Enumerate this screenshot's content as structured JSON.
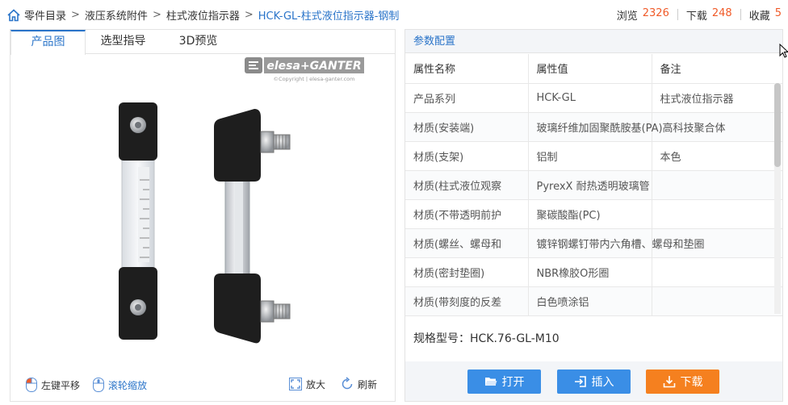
{
  "breadcrumb": {
    "items": [
      "零件目录",
      "液压系统附件",
      "柱式液位指示器",
      "HCK-GL-柱式液位指示器-钢制"
    ],
    "separator": ">"
  },
  "stats": {
    "views_label": "浏览",
    "views": "2326",
    "downloads_label": "下载",
    "downloads": "248",
    "favorites_label": "收藏",
    "favorites": "5"
  },
  "tabs": [
    "产品图",
    "选型指导",
    "3D预览"
  ],
  "viewer": {
    "logo_text": "elesa+GANTER",
    "logo_sub": "©Copyright | elesa-ganter.com",
    "left_drag": "左键平移",
    "wheel_zoom": "滚轮缩放",
    "zoom": "放大",
    "refresh": "刷新"
  },
  "params": {
    "title": "参数配置",
    "headers": [
      "属性名称",
      "属性值",
      "备注"
    ],
    "rows": [
      [
        "产品系列",
        "HCK-GL",
        "柱式液位指示器"
      ],
      [
        "材质(安装端)",
        "玻璃纤维加固聚酰胺基(PA)高科技聚合体",
        ""
      ],
      [
        "材质(支架)",
        "铝制",
        "本色"
      ],
      [
        "材质(柱式液位观察",
        "PyrexX 耐热透明玻璃管",
        ""
      ],
      [
        "材质(不带透明前护",
        "聚碳酸酯(PC)",
        ""
      ],
      [
        "材质(螺丝、螺母和",
        "镀锌钢螺钉带内六角槽、螺母和垫圈",
        ""
      ],
      [
        "材质(密封垫圈)",
        "NBR橡胶O形圈",
        ""
      ],
      [
        "材质(带刻度的反差",
        "白色喷涂铝",
        ""
      ]
    ],
    "spec_label": "规格型号：",
    "spec_value": "HCK.76-GL-M10"
  },
  "actions": {
    "open": "打开",
    "insert": "插入",
    "download": "下载"
  },
  "colors": {
    "accent": "#2a74c9",
    "orange": "#f05a28",
    "button_blue": "#3a8ee6",
    "button_orange": "#f5801f"
  }
}
